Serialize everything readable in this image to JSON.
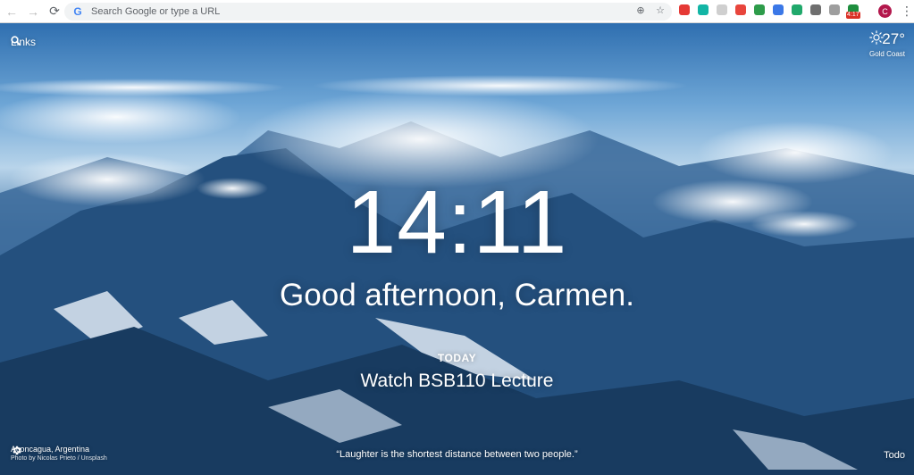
{
  "browser": {
    "omnibox_placeholder": "Search Google or type a URL",
    "extensions": [
      {
        "name": "ext-red-shield-icon",
        "color": "#e53935"
      },
      {
        "name": "ext-teal-circle-icon",
        "color": "#12b5a5"
      },
      {
        "name": "ext-grey-page-icon",
        "color": "#cfcfcf"
      },
      {
        "name": "ext-red-badge-icon",
        "color": "#e8453c"
      },
      {
        "name": "ext-green-shield-icon",
        "color": "#2e9c4a"
      },
      {
        "name": "ext-blue-square-icon",
        "color": "#3b78e7"
      },
      {
        "name": "ext-green-g-icon",
        "color": "#20a86b"
      },
      {
        "name": "ext-pinterest-icon",
        "color": "#6f6f6f"
      },
      {
        "name": "ext-grey-doc-icon",
        "color": "#9e9e9e"
      },
      {
        "name": "ext-green-timer-icon",
        "color": "#1e8e3e"
      }
    ],
    "timer_badge": "4:17",
    "profile_initial": "C"
  },
  "momentum": {
    "links_label": "Links",
    "weather": {
      "temp": "27°",
      "location": "Gold Coast",
      "icon": "sun-icon"
    },
    "clock": "14:11",
    "greeting": "Good afternoon, Carmen.",
    "focus_label": "TODAY",
    "focus_text": "Watch BSB110 Lecture",
    "photo_location": "Aconcagua, Argentina",
    "photo_credit": "Photo by Nicolas Prieto / Unsplash",
    "quote": "“Laughter is the shortest distance between two people.”",
    "todo_label": "Todo"
  }
}
